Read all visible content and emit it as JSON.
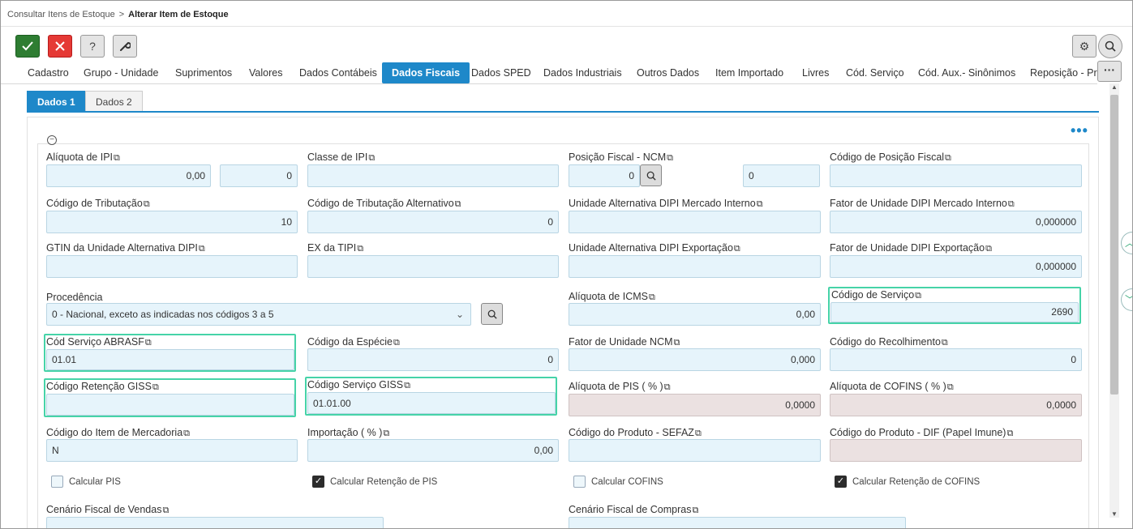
{
  "breadcrumb": {
    "parent": "Consultar Itens de Estoque",
    "separator": ">",
    "current": "Alterar Item de Estoque"
  },
  "toolbar": {
    "confirm_icon": "check-icon",
    "cancel_icon": "close-icon",
    "help_label": "?",
    "tools_icon": "wrench-icon"
  },
  "tabs": [
    "Cadastro",
    "Grupo - Unidade",
    "Suprimentos",
    "Valores",
    "Dados Contábeis",
    "Dados Fiscais",
    "Dados SPED",
    "Dados Industriais",
    "Outros Dados",
    "Item Importado",
    "Livres",
    "Cód. Serviço",
    "Cód. Aux.- Sinônimos",
    "Reposição - Pre"
  ],
  "active_tab": "Dados Fiscais",
  "subtabs": [
    "Dados 1",
    "Dados 2"
  ],
  "colors": {
    "accent": "#1e88c9",
    "highlight": "#46d3a8",
    "input_bg": "#e6f4fb",
    "readonly_bg": "#ebe1e1"
  },
  "fields": {
    "aliquota_ipi": {
      "label": "Alíquota de IPI",
      "value1": "0,00",
      "value2": "0"
    },
    "classe_ipi": {
      "label": "Classe de IPI",
      "value": ""
    },
    "posicao_ncm": {
      "label": "Posição Fiscal - NCM",
      "value": "0",
      "value2": "0"
    },
    "codigo_posicao": {
      "label": "Código de Posição Fiscal",
      "value": ""
    },
    "cod_tributacao": {
      "label": "Código de Tributação",
      "value": "10"
    },
    "cod_trib_alt": {
      "label": "Código de Tributação Alternativo",
      "value": "0"
    },
    "unid_alt_dipi_mi": {
      "label": "Unidade Alternativa DIPI Mercado Interno",
      "value": ""
    },
    "fator_dipi_mi": {
      "label": "Fator de Unidade DIPI Mercado Interno",
      "value": "0,000000"
    },
    "gtin": {
      "label": "GTIN da Unidade Alternativa DIPI",
      "value": ""
    },
    "ex_tipi": {
      "label": "EX da TIPI",
      "value": ""
    },
    "unid_alt_dipi_exp": {
      "label": "Unidade Alternativa DIPI Exportação",
      "value": ""
    },
    "fator_dipi_exp": {
      "label": "Fator de Unidade DIPI Exportação",
      "value": "0,000000"
    },
    "procedencia": {
      "label": "Procedência",
      "value": "0 - Nacional, exceto as indicadas nos códigos 3 a 5"
    },
    "aliquota_icms": {
      "label": "Alíquota de ICMS",
      "value": "0,00"
    },
    "codigo_servico": {
      "label": "Código de Serviço",
      "value": "2690"
    },
    "cod_servico_abrasf": {
      "label": "Cód Serviço ABRASF",
      "value": "01.01"
    },
    "codigo_especie": {
      "label": "Código da Espécie",
      "value": "0"
    },
    "fator_ncm": {
      "label": "Fator de Unidade NCM",
      "value": "0,000"
    },
    "codigo_recolhimento": {
      "label": "Código do Recolhimento",
      "value": "0"
    },
    "cod_retencao_giss": {
      "label": "Código Retenção GISS",
      "value": ""
    },
    "cod_servico_giss": {
      "label": "Código Serviço GISS",
      "value": "01.01.00"
    },
    "aliquota_pis": {
      "label": "Alíquota de PIS ( % )",
      "value": "0,0000"
    },
    "aliquota_cofins": {
      "label": "Alíquota de COFINS ( % )",
      "value": "0,0000"
    },
    "cod_item_mercadoria": {
      "label": "Código do Item de Mercadoria",
      "value": "N"
    },
    "importacao": {
      "label": "Importação ( % )",
      "value": "0,00"
    },
    "cod_produto_sefaz": {
      "label": "Código do Produto - SEFAZ",
      "value": ""
    },
    "cod_produto_dif": {
      "label": "Código do Produto - DIF (Papel Imune)",
      "value": ""
    },
    "cenario_vendas": {
      "label": "Cenário Fiscal de Vendas"
    },
    "cenario_compras": {
      "label": "Cenário Fiscal de Compras"
    }
  },
  "checkboxes": {
    "calc_pis": {
      "label": "Calcular PIS",
      "checked": false
    },
    "calc_ret_pis": {
      "label": "Calcular Retenção de PIS",
      "checked": true
    },
    "calc_cofins": {
      "label": "Calcular COFINS",
      "checked": false
    },
    "calc_ret_cofins": {
      "label": "Calcular Retenção de COFINS",
      "checked": true
    }
  },
  "copy_glyph": "⧉",
  "check_glyph": "✓"
}
